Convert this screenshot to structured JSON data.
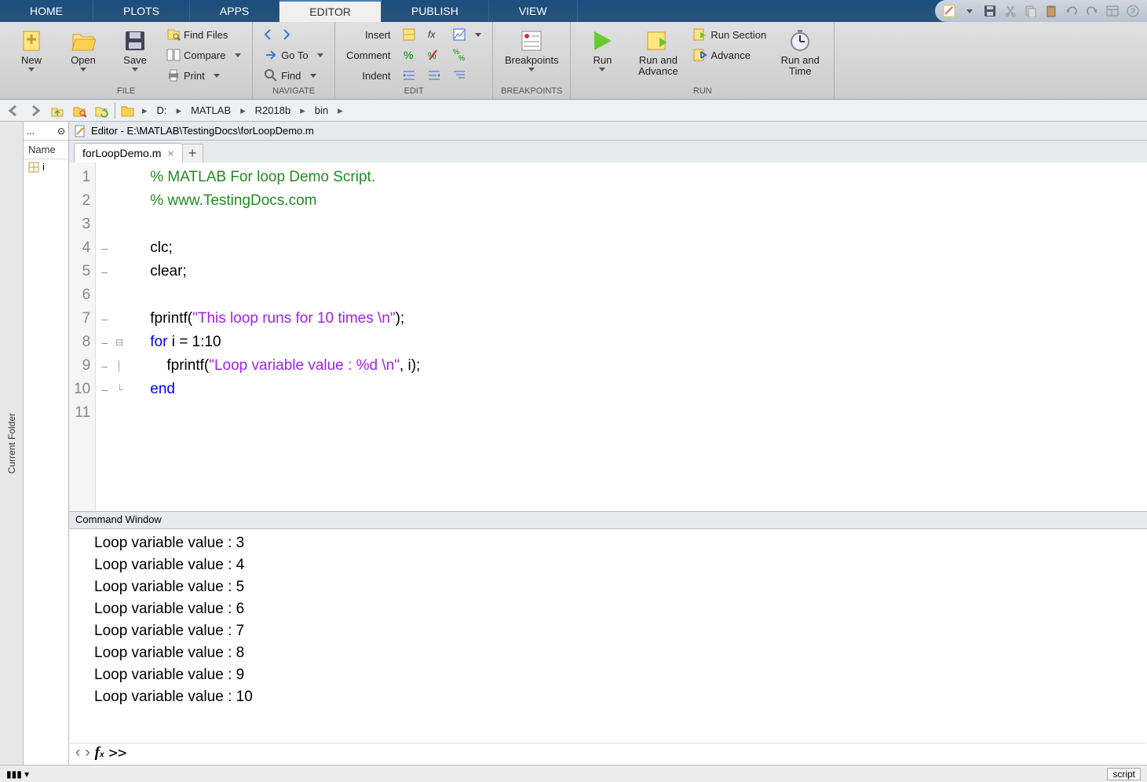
{
  "tabs": [
    "HOME",
    "PLOTS",
    "APPS",
    "EDITOR",
    "PUBLISH",
    "VIEW"
  ],
  "activeTab": "EDITOR",
  "ribbon": {
    "file": {
      "label": "FILE",
      "new": "New",
      "open": "Open",
      "save": "Save",
      "findFiles": "Find Files",
      "compare": "Compare",
      "print": "Print"
    },
    "navigate": {
      "label": "NAVIGATE",
      "goto": "Go To",
      "find": "Find"
    },
    "edit": {
      "label": "EDIT",
      "insert": "Insert",
      "comment": "Comment",
      "indent": "Indent"
    },
    "breakpoints": {
      "label": "BREAKPOINTS",
      "btn": "Breakpoints"
    },
    "run": {
      "label": "RUN",
      "run": "Run",
      "runAdvance": "Run and\nAdvance",
      "runSection": "Run Section",
      "advance": "Advance",
      "runTime": "Run and\nTime"
    }
  },
  "path": {
    "drive": "D:",
    "segs": [
      "MATLAB",
      "R2018b",
      "bin"
    ]
  },
  "workspace": {
    "hdr": "...",
    "col": "Name",
    "var": "i"
  },
  "currentFolder": "Current Folder",
  "editor": {
    "title": "Editor - E:\\MATLAB\\TestingDocs\\forLoopDemo.m",
    "fileTab": "forLoopDemo.m",
    "lines": [
      {
        "n": 1,
        "mark": "",
        "fold": "",
        "seg": [
          {
            "c": "comment",
            "t": "    % MATLAB For loop Demo Script."
          }
        ]
      },
      {
        "n": 2,
        "mark": "",
        "fold": "",
        "seg": [
          {
            "c": "comment",
            "t": "    % www.TestingDocs.com"
          }
        ]
      },
      {
        "n": 3,
        "mark": "",
        "fold": "",
        "seg": [
          {
            "c": "",
            "t": ""
          }
        ]
      },
      {
        "n": 4,
        "mark": "–",
        "fold": "",
        "seg": [
          {
            "c": "",
            "t": "    clc;"
          }
        ]
      },
      {
        "n": 5,
        "mark": "–",
        "fold": "",
        "seg": [
          {
            "c": "",
            "t": "    clear;"
          }
        ]
      },
      {
        "n": 6,
        "mark": "",
        "fold": "",
        "seg": [
          {
            "c": "",
            "t": ""
          }
        ]
      },
      {
        "n": 7,
        "mark": "–",
        "fold": "",
        "seg": [
          {
            "c": "",
            "t": "    fprintf("
          },
          {
            "c": "string",
            "t": "\"This loop runs for 10 times \\n\""
          },
          {
            "c": "",
            "t": ");"
          }
        ]
      },
      {
        "n": 8,
        "mark": "–",
        "fold": "⊟",
        "seg": [
          {
            "c": "keyword",
            "t": "    for"
          },
          {
            "c": "",
            "t": " i = 1:10"
          }
        ]
      },
      {
        "n": 9,
        "mark": "–",
        "fold": "│",
        "seg": [
          {
            "c": "",
            "t": "        fprintf("
          },
          {
            "c": "string",
            "t": "\"Loop variable value : %d \\n\""
          },
          {
            "c": "",
            "t": ", i);"
          }
        ]
      },
      {
        "n": 10,
        "mark": "–",
        "fold": "└",
        "seg": [
          {
            "c": "keyword",
            "t": "    end"
          }
        ]
      },
      {
        "n": 11,
        "mark": "",
        "fold": "",
        "seg": [
          {
            "c": "",
            "t": ""
          }
        ]
      }
    ]
  },
  "cmd": {
    "title": "Command Window",
    "lines": [
      "Loop variable value : 3",
      "Loop variable value : 4",
      "Loop variable value : 5",
      "Loop variable value : 6",
      "Loop variable value : 7",
      "Loop variable value : 8",
      "Loop variable value : 9",
      "Loop variable value : 10"
    ],
    "prompt": ">>"
  },
  "status": {
    "mode": "script"
  }
}
